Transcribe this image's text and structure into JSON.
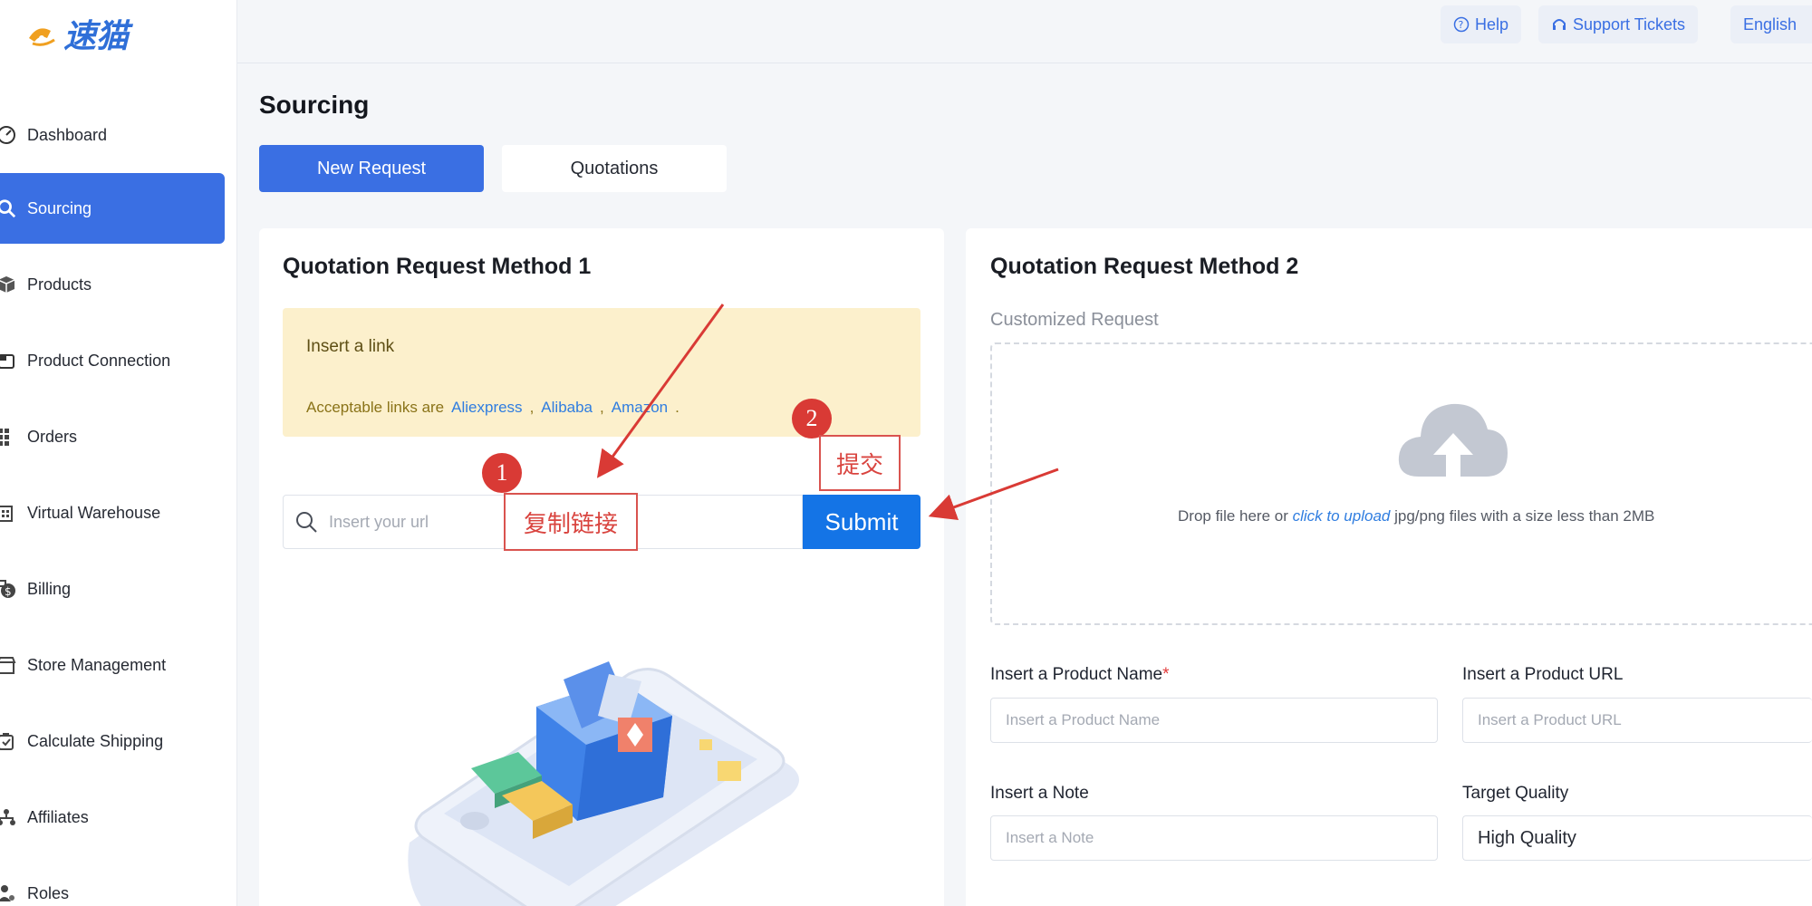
{
  "sidebar": {
    "logo_text": "速猫",
    "items": [
      {
        "label": "Dashboard",
        "icon": "dashboard-gauge-icon"
      },
      {
        "label": "Sourcing",
        "icon": "search-icon",
        "active": true
      },
      {
        "label": "Products",
        "icon": "box-icon"
      },
      {
        "label": "Product Connection",
        "icon": "link-window-icon"
      },
      {
        "label": "Orders",
        "icon": "grid-icon"
      },
      {
        "label": "Virtual Warehouse",
        "icon": "warehouse-icon"
      },
      {
        "label": "Billing",
        "icon": "billing-dollar-icon"
      },
      {
        "label": "Store Management",
        "icon": "store-icon"
      },
      {
        "label": "Calculate Shipping",
        "icon": "shipping-calc-icon"
      },
      {
        "label": "Affiliates",
        "icon": "affiliates-icon"
      },
      {
        "label": "Roles",
        "icon": "roles-icon"
      }
    ]
  },
  "header": {
    "help": "Help",
    "support": "Support Tickets",
    "language": "English"
  },
  "page": {
    "title": "Sourcing",
    "tabs": [
      "New Request",
      "Quotations"
    ]
  },
  "method1": {
    "title": "Quotation Request Method 1",
    "notice_title": "Insert a link",
    "notice_prefix": "Acceptable links are",
    "links": [
      "Aliexpress",
      "Alibaba",
      "Amazon"
    ],
    "url_placeholder": "Insert your url",
    "submit": "Submit"
  },
  "annotations": {
    "step1_number": "1",
    "step1_text": "复制链接",
    "step2_number": "2",
    "step2_text": "提交"
  },
  "method2": {
    "title": "Quotation Request Method 2",
    "subtitle": "Customized Request",
    "drop_prefix": "Drop file here or",
    "drop_link": "click to upload",
    "drop_suffix": "jpg/png files with a size less than 2MB",
    "product_name_label": "Insert a Product Name",
    "product_name_placeholder": "Insert a Product Name",
    "product_url_label": "Insert a Product URL",
    "product_url_placeholder": "Insert a Product URL",
    "note_label": "Insert a Note",
    "note_placeholder": "Insert a Note",
    "quality_label": "Target Quality",
    "quality_value": "High Quality"
  },
  "colors": {
    "primary": "#3a6fe3",
    "submit": "#1474e6",
    "annotation": "#d93a35",
    "notice_bg": "#fcf0cc"
  }
}
